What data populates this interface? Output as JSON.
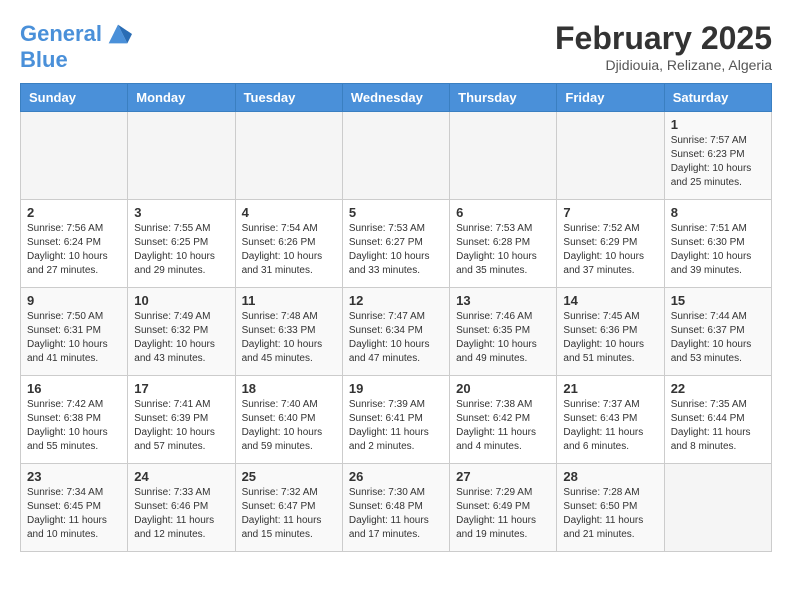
{
  "logo": {
    "line1": "General",
    "line2": "Blue"
  },
  "title": "February 2025",
  "subtitle": "Djidiouia, Relizane, Algeria",
  "days_of_week": [
    "Sunday",
    "Monday",
    "Tuesday",
    "Wednesday",
    "Thursday",
    "Friday",
    "Saturday"
  ],
  "weeks": [
    [
      {
        "day": "",
        "info": ""
      },
      {
        "day": "",
        "info": ""
      },
      {
        "day": "",
        "info": ""
      },
      {
        "day": "",
        "info": ""
      },
      {
        "day": "",
        "info": ""
      },
      {
        "day": "",
        "info": ""
      },
      {
        "day": "1",
        "info": "Sunrise: 7:57 AM\nSunset: 6:23 PM\nDaylight: 10 hours\nand 25 minutes."
      }
    ],
    [
      {
        "day": "2",
        "info": "Sunrise: 7:56 AM\nSunset: 6:24 PM\nDaylight: 10 hours\nand 27 minutes."
      },
      {
        "day": "3",
        "info": "Sunrise: 7:55 AM\nSunset: 6:25 PM\nDaylight: 10 hours\nand 29 minutes."
      },
      {
        "day": "4",
        "info": "Sunrise: 7:54 AM\nSunset: 6:26 PM\nDaylight: 10 hours\nand 31 minutes."
      },
      {
        "day": "5",
        "info": "Sunrise: 7:53 AM\nSunset: 6:27 PM\nDaylight: 10 hours\nand 33 minutes."
      },
      {
        "day": "6",
        "info": "Sunrise: 7:53 AM\nSunset: 6:28 PM\nDaylight: 10 hours\nand 35 minutes."
      },
      {
        "day": "7",
        "info": "Sunrise: 7:52 AM\nSunset: 6:29 PM\nDaylight: 10 hours\nand 37 minutes."
      },
      {
        "day": "8",
        "info": "Sunrise: 7:51 AM\nSunset: 6:30 PM\nDaylight: 10 hours\nand 39 minutes."
      }
    ],
    [
      {
        "day": "9",
        "info": "Sunrise: 7:50 AM\nSunset: 6:31 PM\nDaylight: 10 hours\nand 41 minutes."
      },
      {
        "day": "10",
        "info": "Sunrise: 7:49 AM\nSunset: 6:32 PM\nDaylight: 10 hours\nand 43 minutes."
      },
      {
        "day": "11",
        "info": "Sunrise: 7:48 AM\nSunset: 6:33 PM\nDaylight: 10 hours\nand 45 minutes."
      },
      {
        "day": "12",
        "info": "Sunrise: 7:47 AM\nSunset: 6:34 PM\nDaylight: 10 hours\nand 47 minutes."
      },
      {
        "day": "13",
        "info": "Sunrise: 7:46 AM\nSunset: 6:35 PM\nDaylight: 10 hours\nand 49 minutes."
      },
      {
        "day": "14",
        "info": "Sunrise: 7:45 AM\nSunset: 6:36 PM\nDaylight: 10 hours\nand 51 minutes."
      },
      {
        "day": "15",
        "info": "Sunrise: 7:44 AM\nSunset: 6:37 PM\nDaylight: 10 hours\nand 53 minutes."
      }
    ],
    [
      {
        "day": "16",
        "info": "Sunrise: 7:42 AM\nSunset: 6:38 PM\nDaylight: 10 hours\nand 55 minutes."
      },
      {
        "day": "17",
        "info": "Sunrise: 7:41 AM\nSunset: 6:39 PM\nDaylight: 10 hours\nand 57 minutes."
      },
      {
        "day": "18",
        "info": "Sunrise: 7:40 AM\nSunset: 6:40 PM\nDaylight: 10 hours\nand 59 minutes."
      },
      {
        "day": "19",
        "info": "Sunrise: 7:39 AM\nSunset: 6:41 PM\nDaylight: 11 hours\nand 2 minutes."
      },
      {
        "day": "20",
        "info": "Sunrise: 7:38 AM\nSunset: 6:42 PM\nDaylight: 11 hours\nand 4 minutes."
      },
      {
        "day": "21",
        "info": "Sunrise: 7:37 AM\nSunset: 6:43 PM\nDaylight: 11 hours\nand 6 minutes."
      },
      {
        "day": "22",
        "info": "Sunrise: 7:35 AM\nSunset: 6:44 PM\nDaylight: 11 hours\nand 8 minutes."
      }
    ],
    [
      {
        "day": "23",
        "info": "Sunrise: 7:34 AM\nSunset: 6:45 PM\nDaylight: 11 hours\nand 10 minutes."
      },
      {
        "day": "24",
        "info": "Sunrise: 7:33 AM\nSunset: 6:46 PM\nDaylight: 11 hours\nand 12 minutes."
      },
      {
        "day": "25",
        "info": "Sunrise: 7:32 AM\nSunset: 6:47 PM\nDaylight: 11 hours\nand 15 minutes."
      },
      {
        "day": "26",
        "info": "Sunrise: 7:30 AM\nSunset: 6:48 PM\nDaylight: 11 hours\nand 17 minutes."
      },
      {
        "day": "27",
        "info": "Sunrise: 7:29 AM\nSunset: 6:49 PM\nDaylight: 11 hours\nand 19 minutes."
      },
      {
        "day": "28",
        "info": "Sunrise: 7:28 AM\nSunset: 6:50 PM\nDaylight: 11 hours\nand 21 minutes."
      },
      {
        "day": "",
        "info": ""
      }
    ]
  ]
}
